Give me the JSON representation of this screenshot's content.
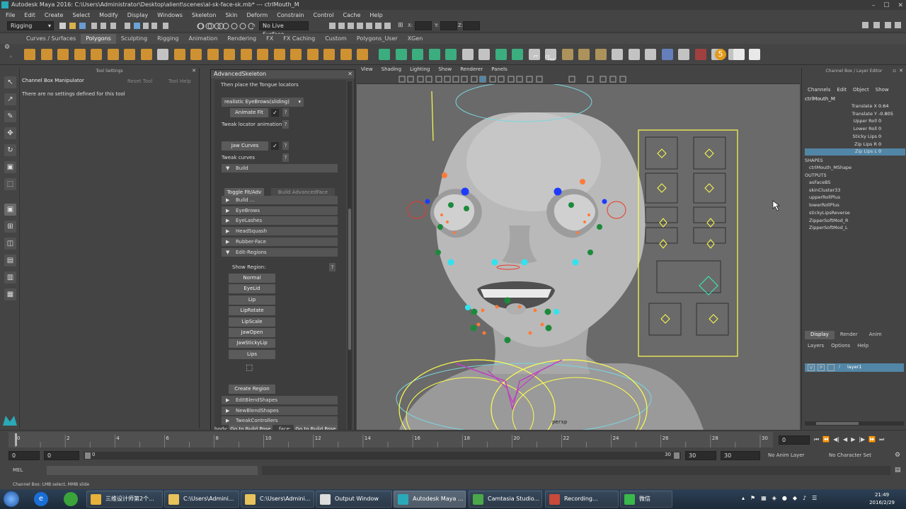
{
  "window": {
    "title": "Autodesk Maya 2016: C:\\Users\\Administrator\\Desktop\\alient\\scenes\\al-sk-face-sk.mb*   ---   ctrlMouth_M"
  },
  "menus": [
    "File",
    "Edit",
    "Create",
    "Select",
    "Modify",
    "Display",
    "Windows",
    "Skeleton",
    "Skin",
    "Deform",
    "Constrain",
    "Control",
    "Cache",
    "Help"
  ],
  "statusline": {
    "mode": "Rigging",
    "live_surface": "No Live Surface",
    "x": "X:",
    "y": "Y:",
    "z": "Z:"
  },
  "shelf_tabs": [
    "Curves / Surfaces",
    "Polygons",
    "Sculpting",
    "Rigging",
    "Animation",
    "Rendering",
    "FX",
    "FX Caching",
    "Custom",
    "Polygons_User",
    "XGen"
  ],
  "shelf_active": "Polygons",
  "shelf_text": {
    "cp": "CP",
    "ft": "FT",
    "hist": "Hist",
    "five": "5"
  },
  "tool_settings": {
    "header": "Tool Settings",
    "title": "Channel Box Manipulator",
    "reset": "Reset Tool",
    "help": "Tool Help",
    "message": "There are no settings defined for this tool"
  },
  "advanced_skeleton": {
    "title": "AdvancedSkeleton",
    "instruction": "Then place the Tongue locators",
    "dropdown": "realistic EyeBrows(sliding)",
    "animate_fit": "Animate Fit",
    "tweak_locator": "Tweak locator animation",
    "jaw_curves": "Jaw Curves",
    "tweak_curves": "Tweak curves",
    "build_frame": "Build",
    "toggle_fit": "Toggle Fit/Adv",
    "build_advanced": "Build AdvancedFace",
    "frames": [
      "Build ...",
      "EyeBrows",
      "EyeLashes",
      "HeadSquash",
      "Rubber-Face",
      "Edit-Regions"
    ],
    "show_region": "Show Region:",
    "regions": [
      "Normal",
      "EyeLid",
      "Lip",
      "LipRotate",
      "LipScale",
      "JawOpen",
      "JawStickyLip",
      "Lips"
    ],
    "create_region": "Create Region",
    "frames_after": [
      "EditBlendShapes",
      "NewBlendShapes",
      "TweakControllers"
    ],
    "body_label": "body:",
    "body_button": "Go to Build Pose",
    "face_label": "face:",
    "face_button": "Go to Build Pose",
    "help": "?",
    "check": "✓"
  },
  "viewport": {
    "menus": [
      "View",
      "Shading",
      "Lighting",
      "Show",
      "Renderer",
      "Panels"
    ],
    "camera": "persp"
  },
  "channel_box": {
    "header": "Channel Box / Layer Editor",
    "menus": [
      "Channels",
      "Edit",
      "Object",
      "Show"
    ],
    "object": "ctrlMouth_M",
    "attributes": [
      {
        "name": "Translate X",
        "value": "0.64"
      },
      {
        "name": "Translate Y",
        "value": "-0.805"
      },
      {
        "name": "Upper Roll",
        "value": "0"
      },
      {
        "name": "Lower Roll",
        "value": "0"
      },
      {
        "name": "Sticky Lips",
        "value": "0"
      },
      {
        "name": "Zip Lips R",
        "value": "0"
      },
      {
        "name": "Zip Lips L",
        "value": "0"
      }
    ],
    "shapes_label": "SHAPES",
    "shape": "ctrlMouth_MShape",
    "outputs_label": "OUTPUTS",
    "outputs": [
      "asFaceBS",
      "skinCluster33",
      "upperRollPlus",
      "lowerRollPlus",
      "stickyLipsReverse",
      "ZipperSoftMod_R",
      "ZipperSoftMod_L"
    ],
    "layer_tabs": [
      "Display",
      "Render",
      "Anim"
    ],
    "layer_menus": [
      "Layers",
      "Options",
      "Help"
    ],
    "layer": {
      "v": "V",
      "p": "P",
      "name": "layer1"
    }
  },
  "timeline": {
    "ticks": [
      "0",
      "2",
      "4",
      "6",
      "8",
      "10",
      "12",
      "14",
      "16",
      "18",
      "20",
      "22",
      "24",
      "26",
      "28",
      "30"
    ],
    "current": "0",
    "range_start": "0",
    "range_inner_start": "0",
    "range_inner_end": "30",
    "range_end": "30",
    "range_end2": "30",
    "anim_layer": "No Anim Layer",
    "char_set": "No Character Set"
  },
  "command_line": {
    "label": "MEL"
  },
  "help_line": "Channel Box: LMB select, MMB slide",
  "taskbar": {
    "items": [
      "三维设计师第2个...",
      "C:\\Users\\Admini...",
      "C:\\Users\\Admini...",
      "Output Window",
      "Autodesk Maya ...",
      "Camtasia Studio...",
      "Recording...",
      "微信"
    ],
    "time": "21:49",
    "date": "2016/2/29"
  },
  "colors": {
    "accent_blue": "#5286a6",
    "rig_yellow": "#ffff4d",
    "ctrl_green": "#1c8a3c",
    "ctrl_cyan": "#2fe3f0",
    "ctrl_blue": "#1d3bff",
    "ctrl_orange": "#ff7a3a",
    "ctrl_red": "#e83a2a"
  }
}
